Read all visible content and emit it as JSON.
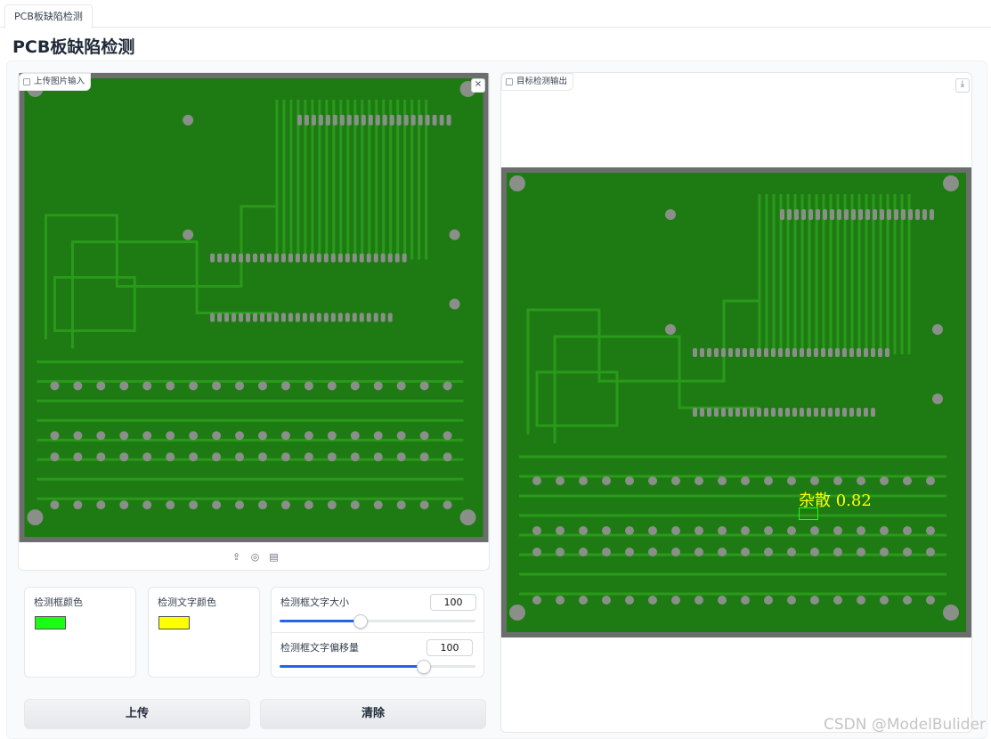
{
  "tab": {
    "label": "PCB板缺陷检测"
  },
  "page_title": "PCB板缺陷检测",
  "input_panel": {
    "label": "上传图片输入",
    "close_glyph": "×"
  },
  "output_panel": {
    "label": "目标检测输出",
    "download_glyph": "⤓"
  },
  "detection": {
    "label": "杂散 0.82"
  },
  "controls": {
    "box_color": {
      "label": "检测框颜色",
      "value": "#19ff12"
    },
    "text_color": {
      "label": "检测文字颜色",
      "value": "#ffff00"
    },
    "font_size": {
      "label": "检测框文字大小",
      "value": "100",
      "fraction": 0.41
    },
    "text_offset": {
      "label": "检测框文字偏移量",
      "value": "100",
      "fraction": 0.73
    }
  },
  "buttons": {
    "upload": "上传",
    "clear": "清除"
  },
  "watermark": "CSDN @ModelBulider",
  "colors": {
    "pcb_board": "#1e7a13",
    "pcb_trace": "#2a9a1b",
    "pcb_pad": "#8a8f8a"
  }
}
